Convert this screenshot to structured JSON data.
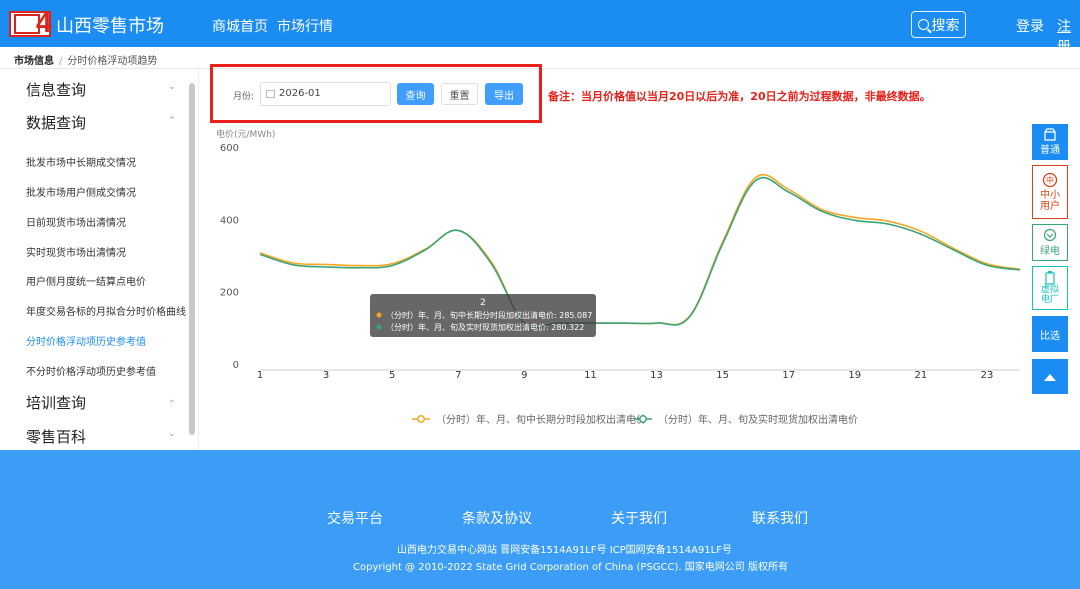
{
  "header": {
    "logo_text": "4",
    "brand_title": "山西零售市场",
    "nav": [
      "商城首页",
      "市场行情"
    ],
    "search_label": "搜索",
    "login": "登录",
    "register": "注册",
    "bg_color": "#1a8cf2"
  },
  "breadcrumb": {
    "root": "市场信息",
    "current": "分时价格浮动项趋势"
  },
  "sidebar": {
    "groups": [
      {
        "label": "信息查询",
        "expanded": false
      },
      {
        "label": "数据查询",
        "expanded": true
      },
      {
        "label": "培训查询",
        "expanded": false
      },
      {
        "label": "零售百科",
        "expanded": false
      }
    ],
    "items": [
      "批发市场中长期成交情况",
      "批发市场用户侧成交情况",
      "日前现货市场出清情况",
      "实时现货市场出清情况",
      "用户侧月度统一结算点电价",
      "年度交易各标的月拟合分时价格曲线",
      "分时价格浮动项历史参考值",
      "不分时价格浮动项历史参考值"
    ],
    "active_index": 6
  },
  "query": {
    "month_label": "月份:",
    "month_value": "2026-01",
    "query_btn": "查询",
    "reset_btn": "重置",
    "export_btn": "导出",
    "note": "备注：当月价格值以当月20日以后为准，20日之前为过程数据，非最终数据。"
  },
  "chart_data": {
    "type": "line",
    "ylabel": "电价(元/MWh)",
    "ylim": [
      0,
      600
    ],
    "yticks": [
      0,
      200,
      400,
      600
    ],
    "x": [
      1,
      2,
      3,
      4,
      5,
      6,
      7,
      8,
      9,
      10,
      11,
      12,
      13,
      14,
      15,
      16,
      17,
      18,
      19,
      20,
      21,
      22,
      23,
      24
    ],
    "xtick_labels": [
      "1",
      "3",
      "5",
      "7",
      "9",
      "11",
      "13",
      "15",
      "17",
      "19",
      "21",
      "23"
    ],
    "series": [
      {
        "name": "（分时）年、月、旬中长期分时段加权出清电价",
        "color": "#f5a623",
        "values": [
          310,
          282,
          278,
          275,
          280,
          320,
          372,
          285.087,
          116,
          116,
          116,
          116,
          116,
          135,
          340,
          518,
          485,
          430,
          408,
          398,
          370,
          322,
          280,
          265
        ]
      },
      {
        "name": "（分时）年、月、旬及实时现货加权出清电价",
        "color": "#3aa57b",
        "values": [
          306,
          277,
          271,
          269,
          275,
          318,
          372,
          280.322,
          116,
          116,
          116,
          116,
          116,
          133,
          335,
          510,
          478,
          425,
          400,
          390,
          362,
          318,
          276,
          263
        ]
      }
    ],
    "tooltip": {
      "x": "2",
      "lines": [
        "（分时）年、月、旬中长期分时段加权出清电价: 285.087",
        "（分时）年、月、旬及实时现货加权出清电价: 280.322"
      ]
    },
    "legend_position": "bottom-center",
    "grid": false
  },
  "right_tools": [
    {
      "label": "普通",
      "icon": "shop-icon",
      "color": "#1a8cf2"
    },
    {
      "label": "中小用户",
      "icon": "zhong-badge-icon",
      "color": "#d9431a"
    },
    {
      "label": "绿电",
      "icon": "leaf-icon",
      "color": "#3aa57b"
    },
    {
      "label": "虚拟电厂",
      "icon": "battery-icon",
      "color": "#19c2c2"
    },
    {
      "label": "比选",
      "icon": "",
      "color": "#1a8cf2"
    },
    {
      "label": "",
      "icon": "arrow-up-icon",
      "color": "#1a8cf2"
    }
  ],
  "footer": {
    "links": [
      "交易平台",
      "条款及协议",
      "关于我们",
      "联系我们"
    ],
    "icp": "山西电力交易中心网站 晋网安备1514A91LF号 ICP国网安备1514A91LF号",
    "copyright": "Copyright @ 2010-2022 State Grid Corporation of China (PSGCC). 国家电网公司 版权所有"
  }
}
